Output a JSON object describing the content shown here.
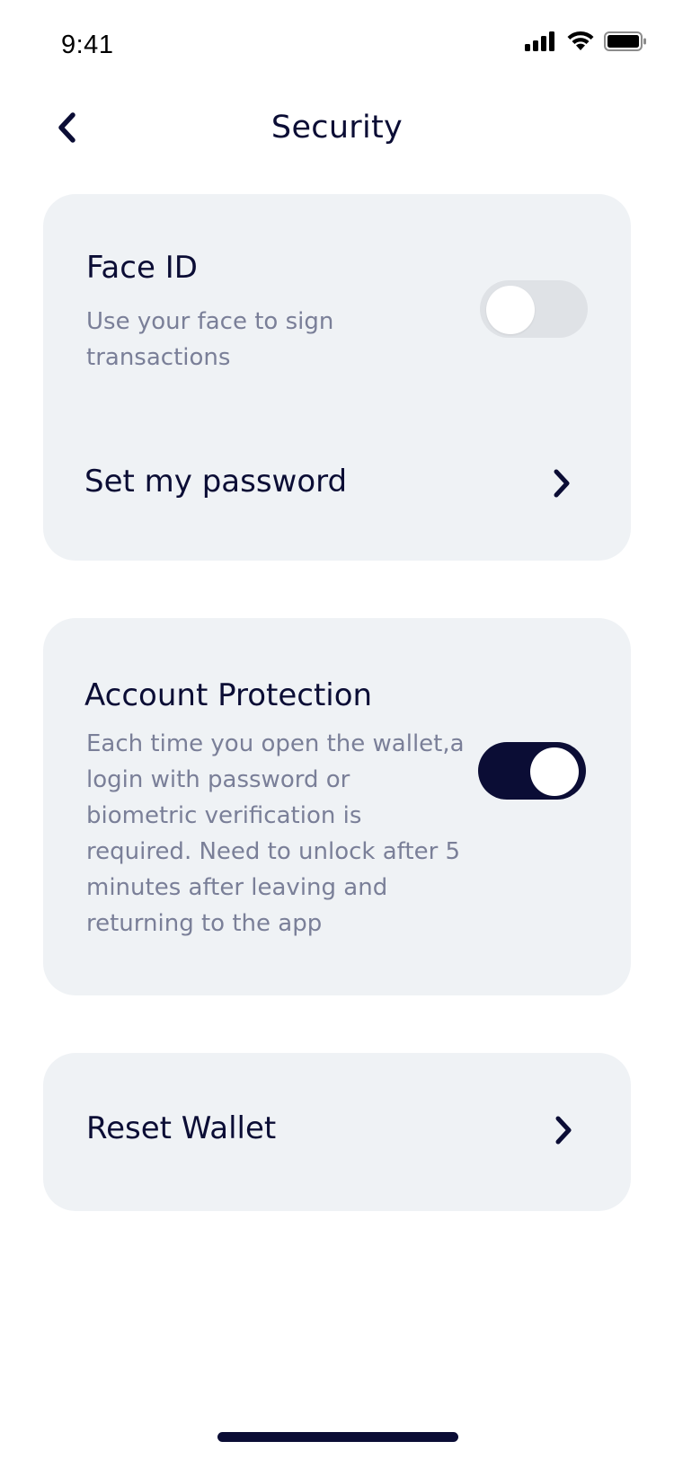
{
  "status_bar": {
    "time": "9:41",
    "icons": [
      "cellular-signal-icon",
      "wifi-icon",
      "battery-icon"
    ]
  },
  "header": {
    "title": "Security",
    "back_icon": "chevron-left-icon"
  },
  "security_card": {
    "face_id": {
      "title": "Face ID",
      "description_line1": "Use your face to sign",
      "description_line2": "transactions",
      "enabled": false
    },
    "password": {
      "label": "Set my password",
      "icon": "chevron-right-icon"
    }
  },
  "account_protection": {
    "title": "Account Protection",
    "description_lines": [
      "Each time you open the wallet,a",
      "login with password or",
      "biometric verification is",
      "required. Need to unlock after 5",
      "minutes after leaving and",
      "returning to the app"
    ],
    "enabled": true
  },
  "reset_wallet": {
    "label": "Reset Wallet",
    "icon": "chevron-right-icon"
  },
  "colors": {
    "primary": "#0b0d35",
    "card_background": "#eff2f5",
    "secondary_text": "#7a7f98",
    "toggle_off": "#dfe2e6"
  }
}
